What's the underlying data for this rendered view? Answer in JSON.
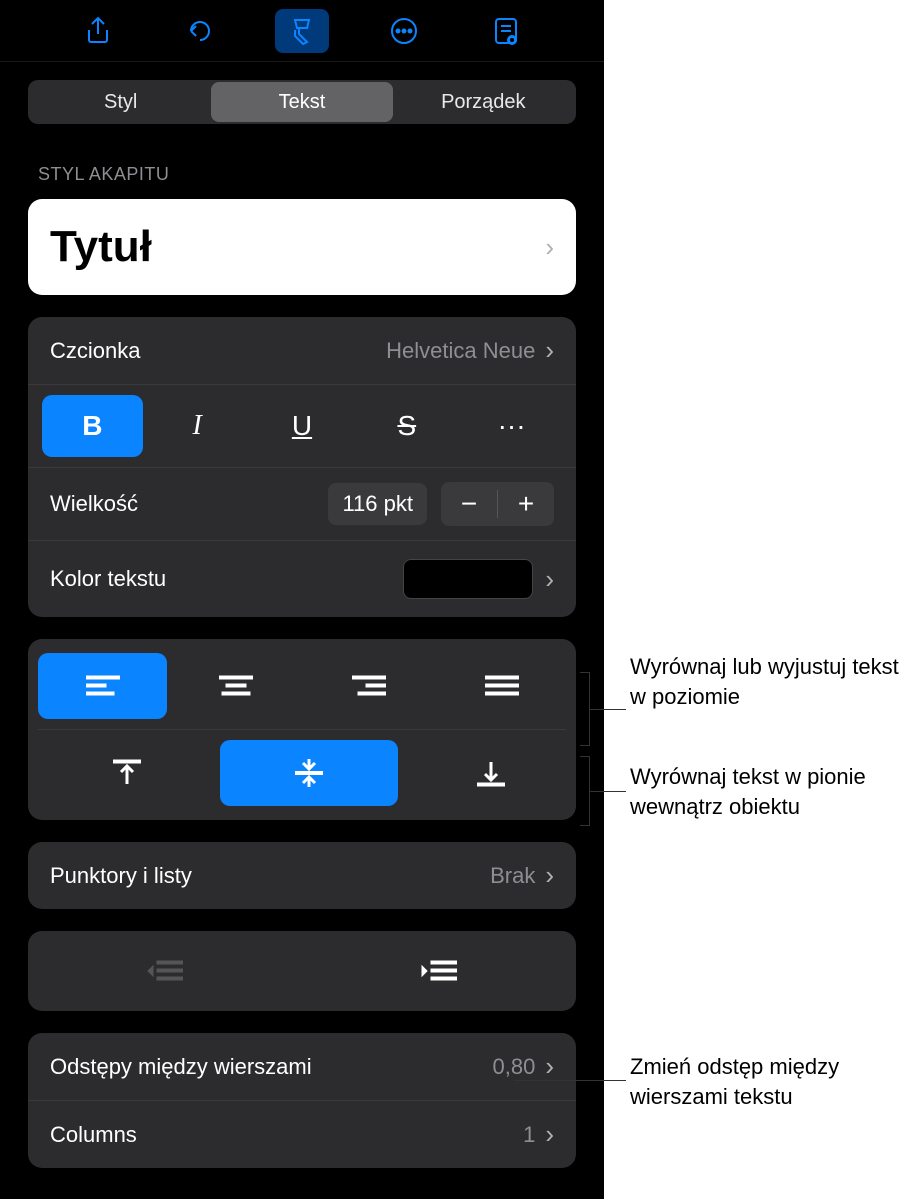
{
  "toolbar": {
    "icons": [
      "share-icon",
      "undo-icon",
      "format-brush-icon",
      "more-icon",
      "reading-mode-icon"
    ]
  },
  "tabs": {
    "items": [
      "Styl",
      "Tekst",
      "Porządek"
    ],
    "active": 1
  },
  "paragraph_style": {
    "label": "STYL AKAPITU",
    "value": "Tytuł"
  },
  "font": {
    "label": "Czcionka",
    "value": "Helvetica Neue",
    "styles": {
      "bold": "B",
      "italic": "I",
      "underline": "U",
      "strike": "S",
      "more": "···"
    },
    "bold_active": true
  },
  "size": {
    "label": "Wielkość",
    "value": "116 pkt"
  },
  "text_color": {
    "label": "Kolor tekstu",
    "swatch": "#000000"
  },
  "bullets": {
    "label": "Punktory i listy",
    "value": "Brak"
  },
  "line_spacing": {
    "label": "Odstępy między wierszami",
    "value": "0,80"
  },
  "columns": {
    "label": "Columns",
    "value": "1"
  },
  "callouts": {
    "halign": "Wyrównaj lub wyjustuj tekst w poziomie",
    "valign": "Wyrównaj tekst w pionie wewnątrz obiektu",
    "spacing": "Zmień odstęp między wierszami tekstu"
  }
}
